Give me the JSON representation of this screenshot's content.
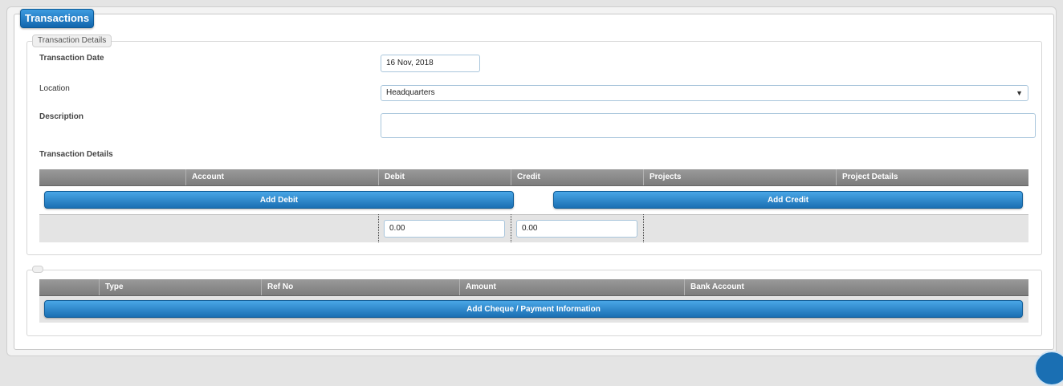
{
  "page": {
    "title": "Transactions"
  },
  "details_section": {
    "legend": "Transaction Details",
    "date_label": "Transaction Date",
    "date_value": "16 Nov, 2018",
    "location_label": "Location",
    "location_value": "Headquarters",
    "description_label": "Description",
    "description_value": "",
    "subheading": "Transaction Details",
    "columns": [
      "",
      "Account",
      "Debit",
      "Credit",
      "Projects",
      "Project Details"
    ],
    "add_debit_label": "Add Debit",
    "add_credit_label": "Add Credit",
    "debit_total": "0.00",
    "credit_total": "0.00"
  },
  "payment_section": {
    "legend": "",
    "columns": [
      "",
      "Type",
      "Ref No",
      "Amount",
      "Bank Account"
    ],
    "add_payment_label": "Add Cheque / Payment Information"
  },
  "icons": {
    "location_dropdown": "chevron-down-icon",
    "help_button": "help-icon"
  },
  "colors": {
    "accent": "#1a6fb3",
    "header_gray": "#8a8a8a"
  }
}
